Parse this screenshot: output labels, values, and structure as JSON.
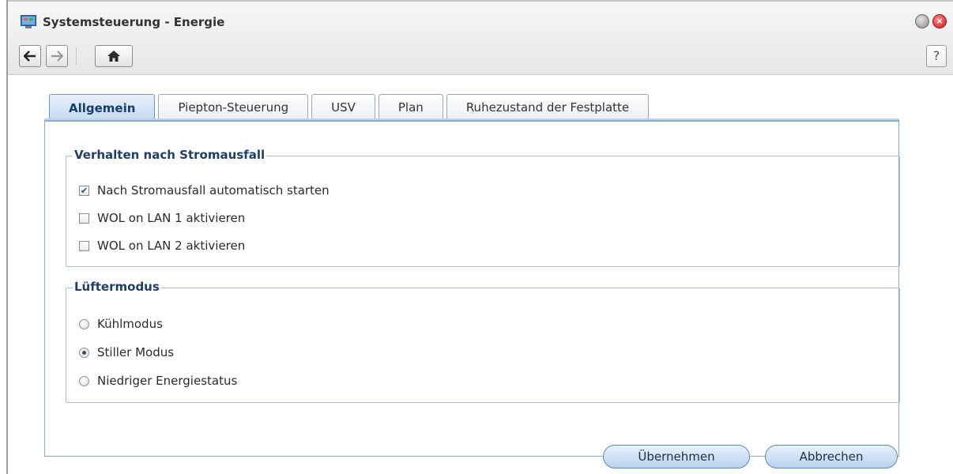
{
  "window": {
    "title": "Systemsteuerung - Energie"
  },
  "toolbar": {
    "back_icon": "arrow-left",
    "forward_icon": "arrow-right",
    "home_icon": "home",
    "help_label": "?"
  },
  "tabs": [
    {
      "label": "Allgemein",
      "active": true
    },
    {
      "label": "Piepton-Steuerung",
      "active": false
    },
    {
      "label": "USV",
      "active": false
    },
    {
      "label": "Plan",
      "active": false
    },
    {
      "label": "Ruhezustand der Festplatte",
      "active": false
    }
  ],
  "section_power": {
    "legend": "Verhalten nach Stromausfall",
    "options": [
      {
        "label": "Nach Stromausfall automatisch starten",
        "checked": true
      },
      {
        "label": "WOL on LAN 1 aktivieren",
        "checked": false
      },
      {
        "label": "WOL on LAN 2 aktivieren",
        "checked": false
      }
    ]
  },
  "section_fan": {
    "legend": "Lüftermodus",
    "options": [
      {
        "label": "Kühlmodus",
        "selected": false
      },
      {
        "label": "Stiller Modus",
        "selected": true
      },
      {
        "label": "Niedriger Energiestatus",
        "selected": false
      }
    ]
  },
  "actions": {
    "apply_label": "Übernehmen",
    "cancel_label": "Abbrechen"
  },
  "colors": {
    "accent": "#163d6b",
    "panel_border": "#87aacd",
    "close": "#d0171b"
  }
}
